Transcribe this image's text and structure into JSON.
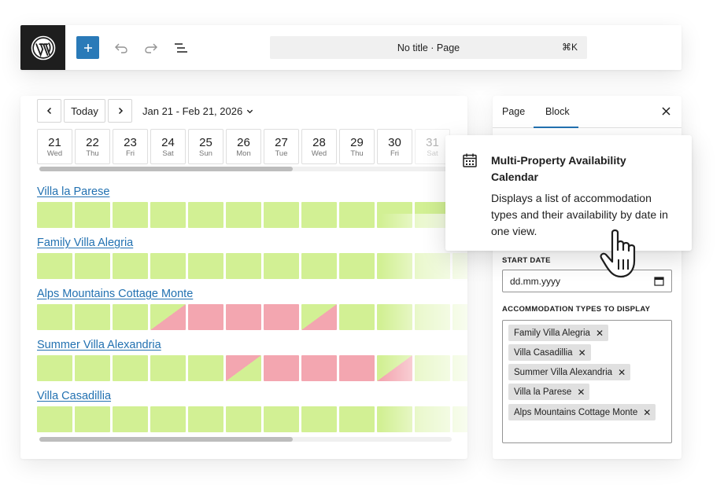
{
  "toolbar": {
    "logo_icon": "wordpress-logo-icon",
    "add_icon": "plus-icon",
    "undo_icon": "undo-icon",
    "redo_icon": "redo-icon",
    "list_view_icon": "list-view-icon",
    "document_title": "No title · Page",
    "shortcut": "⌘K"
  },
  "calendar": {
    "prev_label": "‹",
    "today_label": "Today",
    "next_label": "›",
    "date_range": "Jan 21 - Feb 21, 2026",
    "days": [
      {
        "num": "21",
        "name": "Wed"
      },
      {
        "num": "22",
        "name": "Thu"
      },
      {
        "num": "23",
        "name": "Fri"
      },
      {
        "num": "24",
        "name": "Sat"
      },
      {
        "num": "25",
        "name": "Sun"
      },
      {
        "num": "26",
        "name": "Mon"
      },
      {
        "num": "27",
        "name": "Tue"
      },
      {
        "num": "28",
        "name": "Wed"
      },
      {
        "num": "29",
        "name": "Thu"
      },
      {
        "num": "30",
        "name": "Fri"
      },
      {
        "num": "31",
        "name": "Sat"
      }
    ],
    "properties": [
      {
        "name": "Villa la Parese",
        "cells": [
          "available",
          "available",
          "available",
          "available",
          "available",
          "available",
          "available",
          "available",
          "available",
          "available",
          "available",
          "available"
        ]
      },
      {
        "name": "Family Villa Alegria",
        "cells": [
          "available",
          "available",
          "available",
          "available",
          "available",
          "available",
          "available",
          "available",
          "available",
          "available",
          "available",
          "available"
        ]
      },
      {
        "name": "Alps Mountains Cottage Monte",
        "cells": [
          "available",
          "available",
          "available",
          "checkin",
          "booked",
          "booked",
          "booked",
          "checkin",
          "available",
          "available",
          "available",
          "available"
        ]
      },
      {
        "name": "Summer Villa Alexandria",
        "cells": [
          "available",
          "available",
          "available",
          "available",
          "available",
          "checkout",
          "booked",
          "booked",
          "booked",
          "checkin",
          "available",
          "available"
        ]
      },
      {
        "name": "Villa Casadillia",
        "cells": [
          "available",
          "available",
          "available",
          "available",
          "available",
          "available",
          "available",
          "available",
          "available",
          "available",
          "available",
          "available"
        ]
      }
    ]
  },
  "sidebar": {
    "tab_page": "Page",
    "tab_block": "Block",
    "close_label": "×",
    "start_date_label": "START DATE",
    "start_date_placeholder": "dd.mm.yyyy",
    "types_label": "ACCOMMODATION TYPES TO DISPLAY",
    "tokens": [
      "Family Villa Alegria",
      "Villa Casadillia",
      "Summer Villa Alexandria",
      "Villa la Parese",
      "Alps Mountains Cottage Monte"
    ]
  },
  "block_card": {
    "icon": "calendar-icon",
    "title": "Multi-Property Availability Calendar",
    "description": "Displays a list of accommodation types and their availability by date in one view."
  },
  "colors": {
    "available": "#d2f094",
    "booked": "#f3a6b0",
    "accent": "#2271b1",
    "primary_button": "#2a7ab8"
  }
}
